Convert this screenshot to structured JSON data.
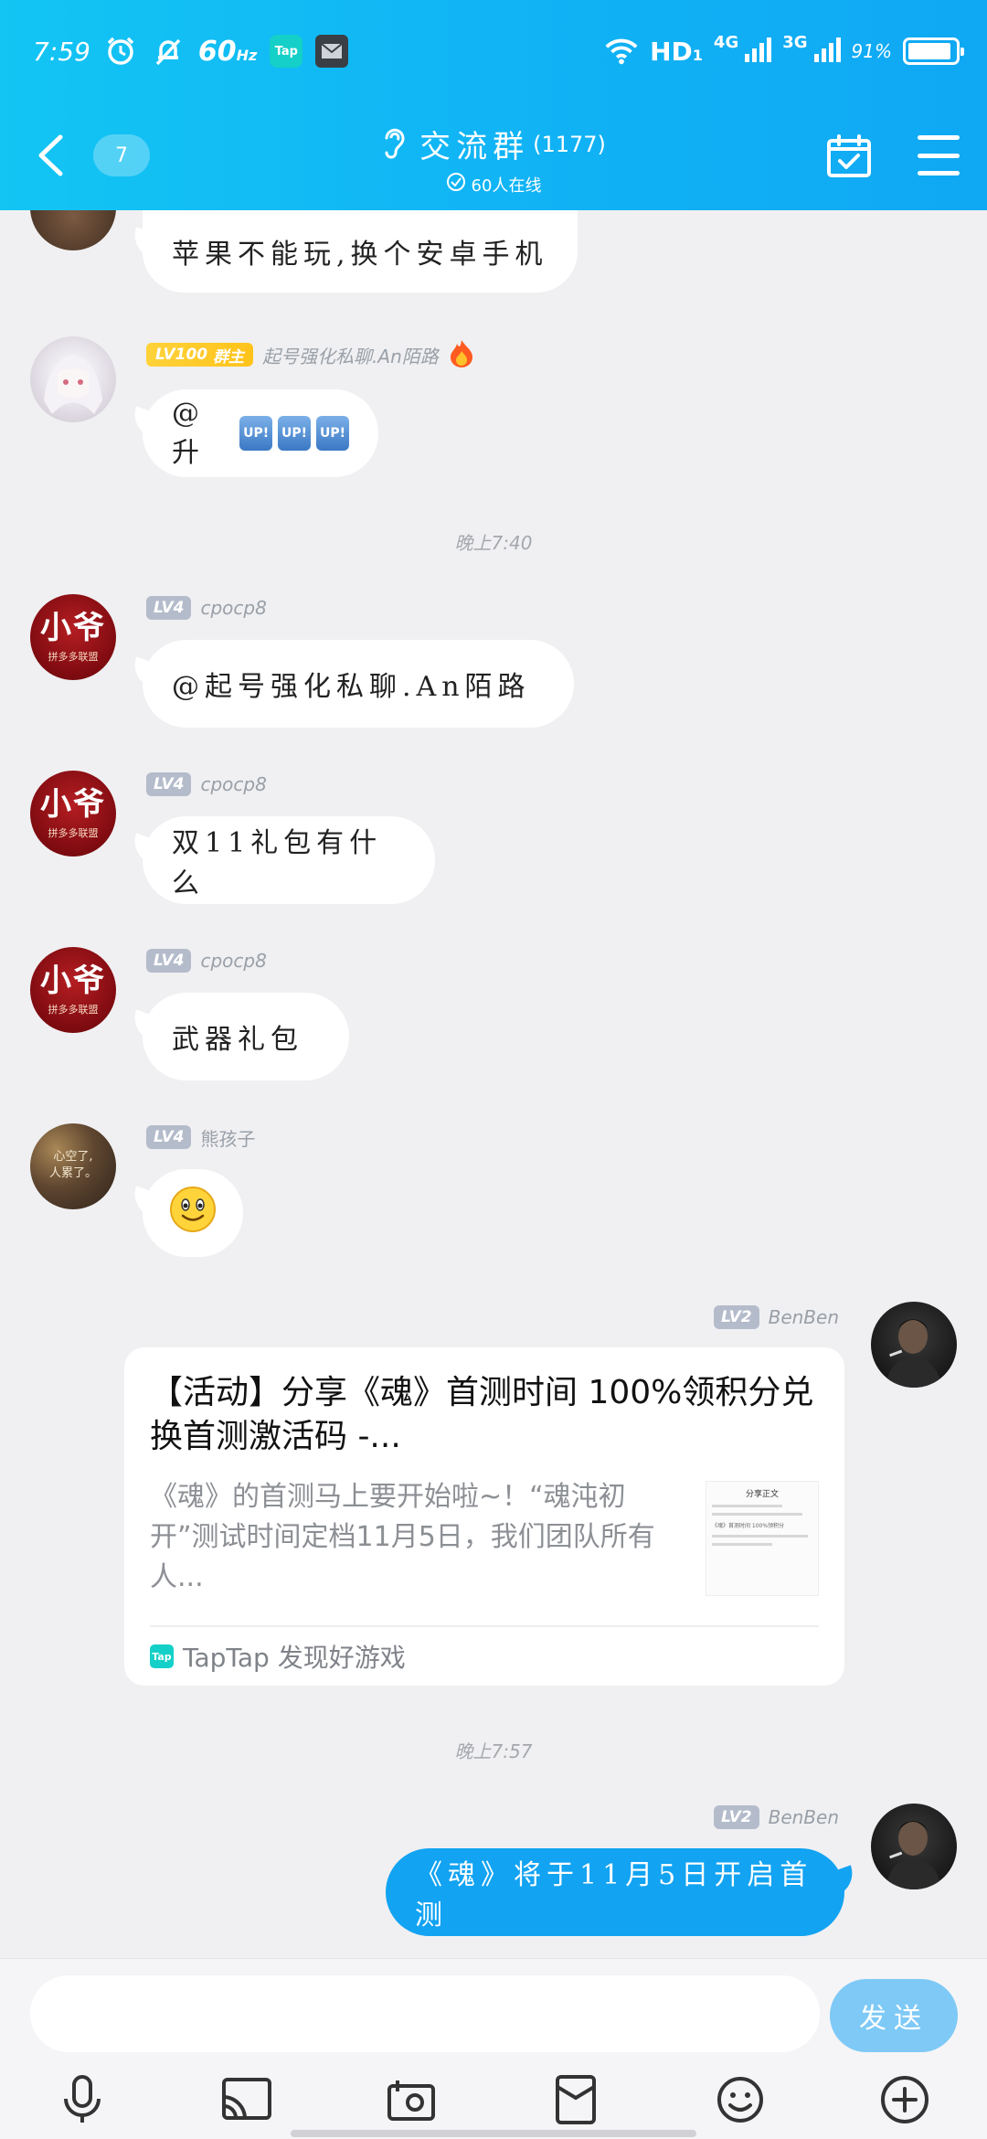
{
  "status_bar": {
    "time": "7:59",
    "refresh_rate": "60",
    "refresh_unit": "Hz",
    "tap_badge": "Tap",
    "network_hd": "HD",
    "network_hd_sub": "1",
    "network_4g": "4G",
    "network_3g": "3G",
    "battery_pct": "91%",
    "battery_level": 0.91
  },
  "header": {
    "unread_count": "7",
    "title": "交流群",
    "member_count": "(1177)",
    "online_text": "60人在线"
  },
  "messages": [
    {
      "text": "苹果不能玩,换个安卓手机"
    },
    {
      "level": "LV100",
      "role": "群主",
      "nickname": "起号强化私聊.An陌路",
      "text": "@升",
      "emoji": "UP!"
    },
    {
      "level": "LV4",
      "nickname": "cpocp8",
      "text": "@起号强化私聊.An陌路"
    },
    {
      "level": "LV4",
      "nickname": "cpocp8",
      "text": "双11礼包有什么"
    },
    {
      "level": "LV4",
      "nickname": "cpocp8",
      "text": "武器礼包"
    },
    {
      "level": "LV4",
      "nickname": "熊孩子",
      "text": ""
    },
    {
      "level": "LV2",
      "nickname": "BenBen"
    },
    {
      "level": "LV2",
      "nickname": "BenBen",
      "text": "《魂》将于11月5日开启首测"
    }
  ],
  "avatars": {
    "xiaoye_text": "小爷",
    "xiaoye_sub": "拼多多联盟",
    "bokeh_text_1": "心空了,",
    "bokeh_text_2": "人累了。"
  },
  "time_separators": [
    "晚上7:40",
    "晚上7:57"
  ],
  "share_card": {
    "title": "【活动】分享《魂》首测时间 100%领积分兑换首测激活码 -...",
    "body": "《魂》的首测马上要开始啦~！“魂沌初开”测试时间定档11月5日，我们团队所有人...",
    "source": "TapTap 发现好游戏",
    "thumb_title": "分享正文",
    "thumb_caption": "《魂》首测时间 100%领积分"
  },
  "input": {
    "placeholder": "",
    "send_label": "发送"
  },
  "colors": {
    "header_start": "#12c5f3",
    "header_end": "#0fa8f3",
    "my_bubble": "#12a3f2",
    "send_button": "#7ec9f6",
    "owner_badge": "#ffc31a",
    "level_badge": "#b4bccb"
  },
  "toolbar_icons": [
    "microphone-icon",
    "cast-icon",
    "camera-icon",
    "red-envelope-icon",
    "smile-icon",
    "plus-icon"
  ]
}
